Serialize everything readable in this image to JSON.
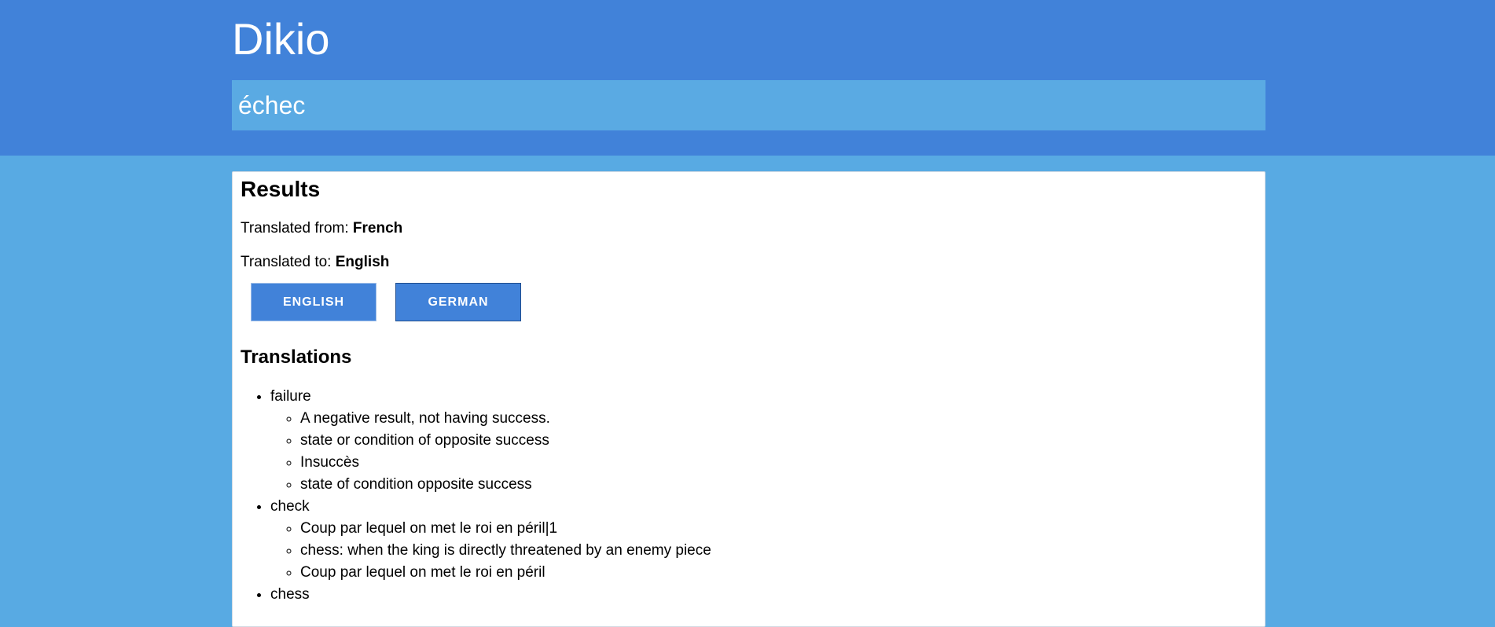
{
  "header": {
    "title": "Dikio",
    "search_value": "échec"
  },
  "results": {
    "heading": "Results",
    "from_label": "Translated from: ",
    "from_lang": "French",
    "to_label": "Translated to: ",
    "to_lang": "English",
    "buttons": [
      "ENGLISH",
      "GERMAN"
    ],
    "translations_heading": "Translations",
    "translations": [
      {
        "word": "failure",
        "definitions": [
          "A negative result, not having success.",
          "state or condition of opposite success",
          "Insuccès",
          "state of condition opposite success"
        ]
      },
      {
        "word": "check",
        "definitions": [
          "Coup par lequel on met le roi en péril|1",
          "chess: when the king is directly threatened by an enemy piece",
          "Coup par lequel on met le roi en péril"
        ]
      },
      {
        "word": "chess",
        "definitions": []
      }
    ]
  },
  "colors": {
    "header_bg": "#4182d9",
    "page_bg": "#58aae3",
    "button_bg": "#4182d9"
  }
}
